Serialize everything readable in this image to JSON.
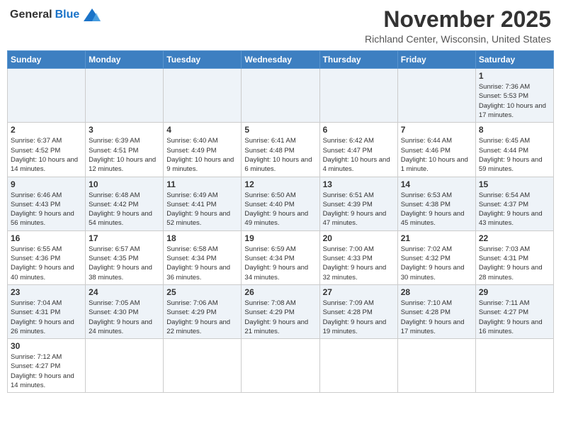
{
  "header": {
    "logo_general": "General",
    "logo_blue": "Blue",
    "month_title": "November 2025",
    "location": "Richland Center, Wisconsin, United States"
  },
  "weekdays": [
    "Sunday",
    "Monday",
    "Tuesday",
    "Wednesday",
    "Thursday",
    "Friday",
    "Saturday"
  ],
  "weeks": [
    [
      {
        "day": "",
        "info": ""
      },
      {
        "day": "",
        "info": ""
      },
      {
        "day": "",
        "info": ""
      },
      {
        "day": "",
        "info": ""
      },
      {
        "day": "",
        "info": ""
      },
      {
        "day": "",
        "info": ""
      },
      {
        "day": "1",
        "info": "Sunrise: 7:36 AM\nSunset: 5:53 PM\nDaylight: 10 hours and 17 minutes."
      }
    ],
    [
      {
        "day": "2",
        "info": "Sunrise: 6:37 AM\nSunset: 4:52 PM\nDaylight: 10 hours and 14 minutes."
      },
      {
        "day": "3",
        "info": "Sunrise: 6:39 AM\nSunset: 4:51 PM\nDaylight: 10 hours and 12 minutes."
      },
      {
        "day": "4",
        "info": "Sunrise: 6:40 AM\nSunset: 4:49 PM\nDaylight: 10 hours and 9 minutes."
      },
      {
        "day": "5",
        "info": "Sunrise: 6:41 AM\nSunset: 4:48 PM\nDaylight: 10 hours and 6 minutes."
      },
      {
        "day": "6",
        "info": "Sunrise: 6:42 AM\nSunset: 4:47 PM\nDaylight: 10 hours and 4 minutes."
      },
      {
        "day": "7",
        "info": "Sunrise: 6:44 AM\nSunset: 4:46 PM\nDaylight: 10 hours and 1 minute."
      },
      {
        "day": "8",
        "info": "Sunrise: 6:45 AM\nSunset: 4:44 PM\nDaylight: 9 hours and 59 minutes."
      }
    ],
    [
      {
        "day": "9",
        "info": "Sunrise: 6:46 AM\nSunset: 4:43 PM\nDaylight: 9 hours and 56 minutes."
      },
      {
        "day": "10",
        "info": "Sunrise: 6:48 AM\nSunset: 4:42 PM\nDaylight: 9 hours and 54 minutes."
      },
      {
        "day": "11",
        "info": "Sunrise: 6:49 AM\nSunset: 4:41 PM\nDaylight: 9 hours and 52 minutes."
      },
      {
        "day": "12",
        "info": "Sunrise: 6:50 AM\nSunset: 4:40 PM\nDaylight: 9 hours and 49 minutes."
      },
      {
        "day": "13",
        "info": "Sunrise: 6:51 AM\nSunset: 4:39 PM\nDaylight: 9 hours and 47 minutes."
      },
      {
        "day": "14",
        "info": "Sunrise: 6:53 AM\nSunset: 4:38 PM\nDaylight: 9 hours and 45 minutes."
      },
      {
        "day": "15",
        "info": "Sunrise: 6:54 AM\nSunset: 4:37 PM\nDaylight: 9 hours and 43 minutes."
      }
    ],
    [
      {
        "day": "16",
        "info": "Sunrise: 6:55 AM\nSunset: 4:36 PM\nDaylight: 9 hours and 40 minutes."
      },
      {
        "day": "17",
        "info": "Sunrise: 6:57 AM\nSunset: 4:35 PM\nDaylight: 9 hours and 38 minutes."
      },
      {
        "day": "18",
        "info": "Sunrise: 6:58 AM\nSunset: 4:34 PM\nDaylight: 9 hours and 36 minutes."
      },
      {
        "day": "19",
        "info": "Sunrise: 6:59 AM\nSunset: 4:34 PM\nDaylight: 9 hours and 34 minutes."
      },
      {
        "day": "20",
        "info": "Sunrise: 7:00 AM\nSunset: 4:33 PM\nDaylight: 9 hours and 32 minutes."
      },
      {
        "day": "21",
        "info": "Sunrise: 7:02 AM\nSunset: 4:32 PM\nDaylight: 9 hours and 30 minutes."
      },
      {
        "day": "22",
        "info": "Sunrise: 7:03 AM\nSunset: 4:31 PM\nDaylight: 9 hours and 28 minutes."
      }
    ],
    [
      {
        "day": "23",
        "info": "Sunrise: 7:04 AM\nSunset: 4:31 PM\nDaylight: 9 hours and 26 minutes."
      },
      {
        "day": "24",
        "info": "Sunrise: 7:05 AM\nSunset: 4:30 PM\nDaylight: 9 hours and 24 minutes."
      },
      {
        "day": "25",
        "info": "Sunrise: 7:06 AM\nSunset: 4:29 PM\nDaylight: 9 hours and 22 minutes."
      },
      {
        "day": "26",
        "info": "Sunrise: 7:08 AM\nSunset: 4:29 PM\nDaylight: 9 hours and 21 minutes."
      },
      {
        "day": "27",
        "info": "Sunrise: 7:09 AM\nSunset: 4:28 PM\nDaylight: 9 hours and 19 minutes."
      },
      {
        "day": "28",
        "info": "Sunrise: 7:10 AM\nSunset: 4:28 PM\nDaylight: 9 hours and 17 minutes."
      },
      {
        "day": "29",
        "info": "Sunrise: 7:11 AM\nSunset: 4:27 PM\nDaylight: 9 hours and 16 minutes."
      }
    ],
    [
      {
        "day": "30",
        "info": "Sunrise: 7:12 AM\nSunset: 4:27 PM\nDaylight: 9 hours and 14 minutes."
      },
      {
        "day": "",
        "info": ""
      },
      {
        "day": "",
        "info": ""
      },
      {
        "day": "",
        "info": ""
      },
      {
        "day": "",
        "info": ""
      },
      {
        "day": "",
        "info": ""
      },
      {
        "day": "",
        "info": ""
      }
    ]
  ]
}
